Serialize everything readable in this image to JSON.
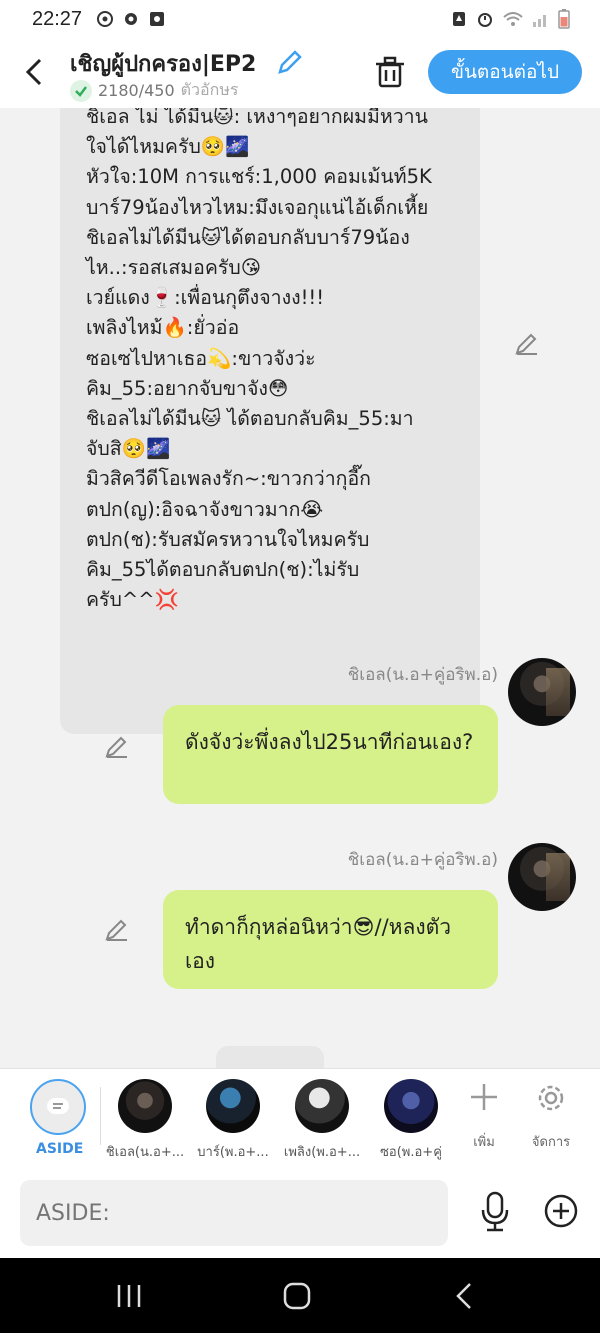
{
  "status": {
    "time": "22:27"
  },
  "header": {
    "title": "เชิญผู้ปกครอง|EP2",
    "counter": "2180/450",
    "counter_unit": "ตัวอักษร",
    "next_button": "ขั้นตอนต่อไป"
  },
  "big_message": {
    "lines": [
      "ชิเอล ไม่ ได้มีน🐱: เหงาๆอยากผมมีหวาน",
      "ใจได้ไหมครับ🥺🌌",
      "หัวใจ:10M การแชร์:1,000 คอมเม้นท์5K",
      "บาร์79น้องไหวไหม:มึงเจอกุแน่ไอ้เด็กเหี้ย",
      "ชิเอลไม่ได้มีน🐱ได้ตอบกลับบาร์79น้อง",
      "ไห..:รอสเสมอครับ😘",
      "เวย์แดง🍷:เพื่อนกุตึงจางง!!!",
      "เพลิงไหม้🔥:ยั่วอ่อ",
      "ซอเซไปหาเธอ💫:ขาวจังว่ะ",
      "คิม_55:อยากจับขาจัง😳",
      "ชิเอลไม่ได้มีน🐱 ได้ตอบกลับคิม_55:มา",
      "จับสิ🥺🌌",
      "มิวสิควีดีโอเพลงรัก~:ขาวกว่ากุอี๊ก",
      "ตปก(ญ):อิจฉาจังขาวมาก😭",
      "ตปก(ช):รับสมัครหวานใจไหมครับ",
      "คิม_55ได้ตอบกลับตปก(ช):ไม่รับ",
      "ครับ^^💢"
    ]
  },
  "messages": [
    {
      "sender": "ชิเอล(น.อ+คู่อริพ.อ)",
      "text": "ดังจังว่ะพึ่งลงไป25นาทีก่อนเอง?"
    },
    {
      "sender": "ชิเอล(น.อ+คู่อริพ.อ)",
      "text": "ทำดาก็กุหล่อนิหว่า😎//หลงตัวเอง"
    }
  ],
  "bottom": {
    "aside_label": "ASIDE",
    "characters": [
      {
        "label": "ชิเอล(น.อ+...",
        "color": "#2b2624"
      },
      {
        "label": "บาร์(พ.อ+...",
        "color": "#2a4d6e"
      },
      {
        "label": "เพลิง(พ.อ+...",
        "color": "#d8d8d8"
      },
      {
        "label": "ซอ(พ.อ+คู่",
        "color": "#2a3a7a"
      }
    ],
    "add_label": "เพิ่ม",
    "manage_label": "จัดการ"
  },
  "input": {
    "placeholder": "ASIDE:"
  },
  "colors": {
    "accent": "#3ea0f0",
    "bubble_green": "#d6f08a",
    "bubble_gray": "#e6e6e6"
  }
}
